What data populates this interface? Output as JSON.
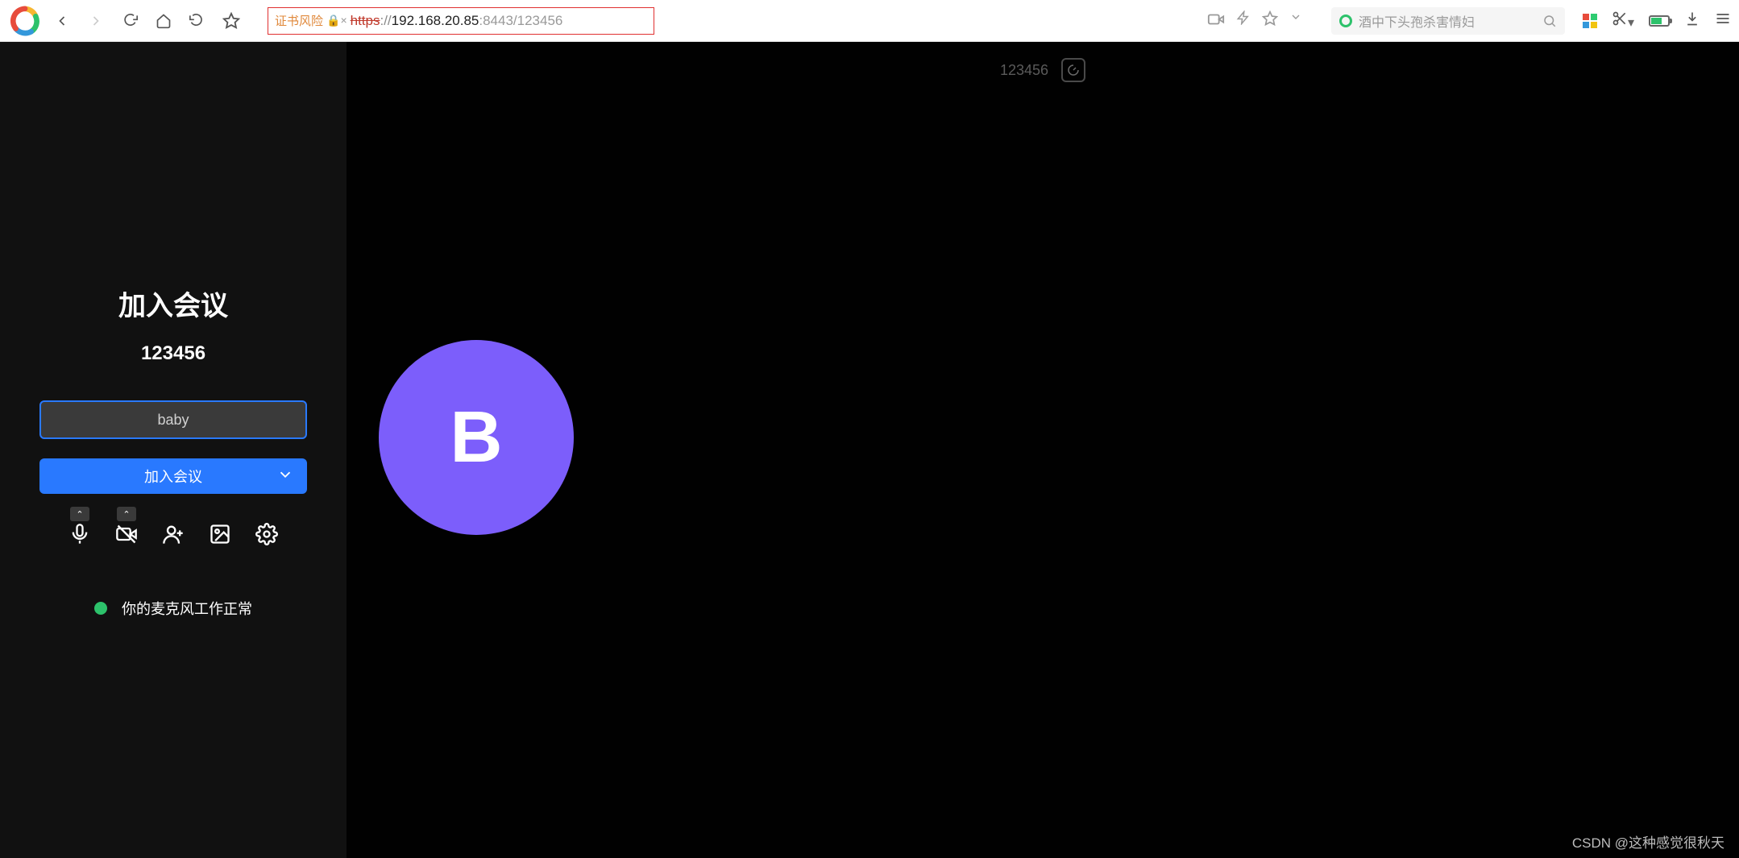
{
  "browser": {
    "cert_warning": "证书风险",
    "url_scheme": "https",
    "url_sep": "://",
    "url_host": "192.168.20.85",
    "url_port": ":8443",
    "url_path": "/123456",
    "search_placeholder": "酒中下头孢杀害情妇"
  },
  "meeting": {
    "title": "加入会议",
    "id": "123456",
    "name_value": "baby",
    "join_label": "加入会议",
    "top_id": "123456",
    "avatar_letter": "B",
    "status_text": "你的麦克风工作正常"
  },
  "watermark": "CSDN @这种感觉很秋天",
  "colors": {
    "accent": "#2979ff",
    "avatar": "#7c5efb",
    "ok": "#2dc26b",
    "warn_border": "#e03030"
  }
}
